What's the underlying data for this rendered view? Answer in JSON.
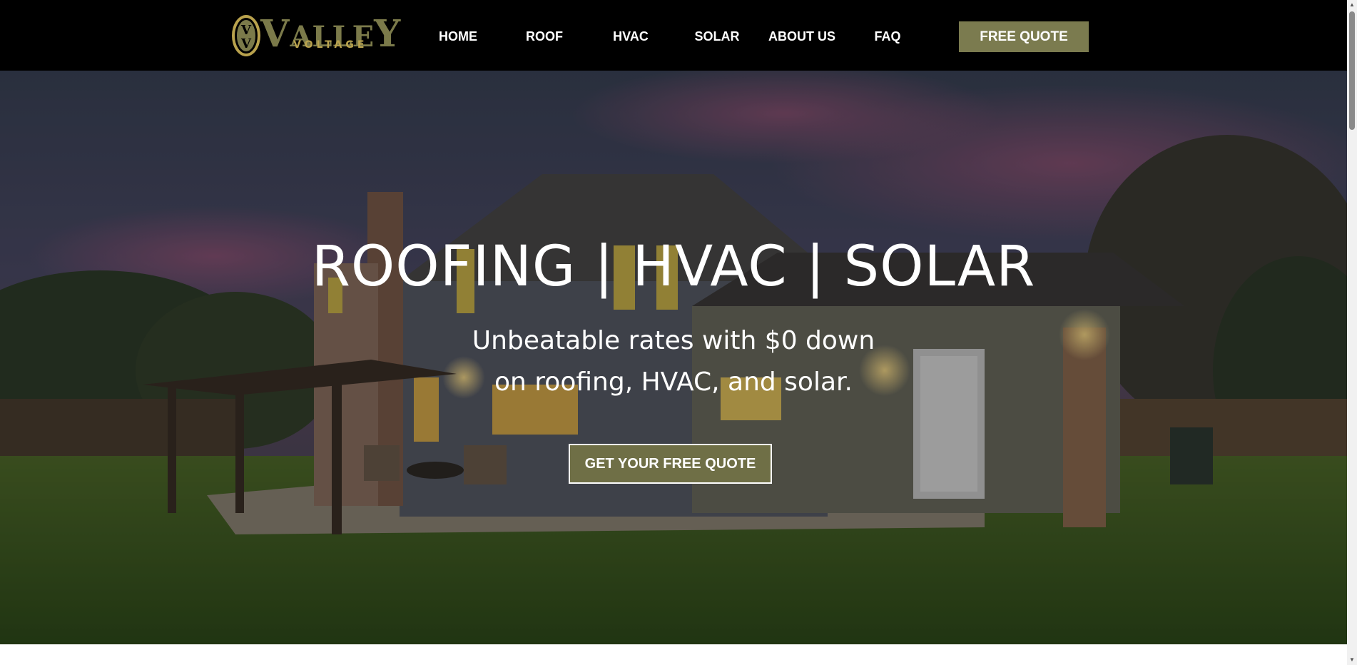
{
  "brand": {
    "name_first": "V",
    "name_mid": "ALLE",
    "name_last": "Y",
    "tagline": "VOLTAGE",
    "emblem_letters": "VV",
    "colors": {
      "olive": "#7b7a4a",
      "gold": "#b9a24d",
      "button": "#7b7b4f"
    }
  },
  "nav": {
    "items": [
      {
        "label": "HOME"
      },
      {
        "label": "ROOF"
      },
      {
        "label": "HVAC"
      },
      {
        "label": "SOLAR"
      },
      {
        "label": "ABOUT US"
      },
      {
        "label": "FAQ"
      }
    ],
    "cta_label": "FREE QUOTE"
  },
  "hero": {
    "title": "ROOFING | HVAC | SOLAR",
    "subtitle_line1": "Unbeatable rates with $0 down",
    "subtitle_line2": "on roofing, HVAC, and solar.",
    "cta_label": "GET YOUR FREE QUOTE"
  },
  "icons": {
    "scroll_up": "triangle-up",
    "scroll_down": "triangle-down"
  }
}
